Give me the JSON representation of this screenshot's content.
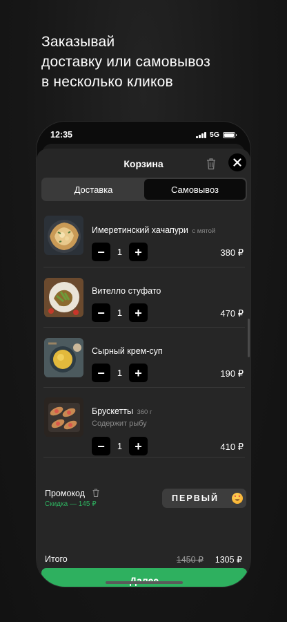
{
  "headline": [
    "Заказывай",
    "доставку или самовывоз",
    "в несколько кликов"
  ],
  "status_bar": {
    "time": "12:35",
    "network": "5G"
  },
  "cart": {
    "title": "Корзина",
    "tabs": [
      {
        "label": "Доставка",
        "active": false
      },
      {
        "label": "Самовывоз",
        "active": true
      }
    ],
    "items": [
      {
        "name": "Имеретинский хачапури",
        "extra": "с мятой",
        "note": "",
        "quantity": "1",
        "price": "380 ₽",
        "image": "khachapuri-photo"
      },
      {
        "name": "Вителло стуфато",
        "extra": "",
        "note": "",
        "quantity": "1",
        "price": "470 ₽",
        "image": "vitello-photo"
      },
      {
        "name": "Сырный крем-суп",
        "extra": "",
        "note": "",
        "quantity": "1",
        "price": "190 ₽",
        "image": "cream-soup-photo"
      },
      {
        "name": "Брускетты",
        "extra": "360 г",
        "note": "Содержит рыбу",
        "quantity": "1",
        "price": "410 ₽",
        "image": "bruschetta-photo"
      }
    ],
    "promo": {
      "label": "Промокод",
      "discount": "Скидка — 145 ₽",
      "code": "ПЕРВЫЙ"
    },
    "total": {
      "label": "Итого",
      "old_price": "1450 ₽",
      "new_price": "1305 ₽"
    },
    "cta_label": "Далее"
  },
  "colors": {
    "accent": "#2eb05f",
    "background": "#161616",
    "sheet": "#262626"
  }
}
